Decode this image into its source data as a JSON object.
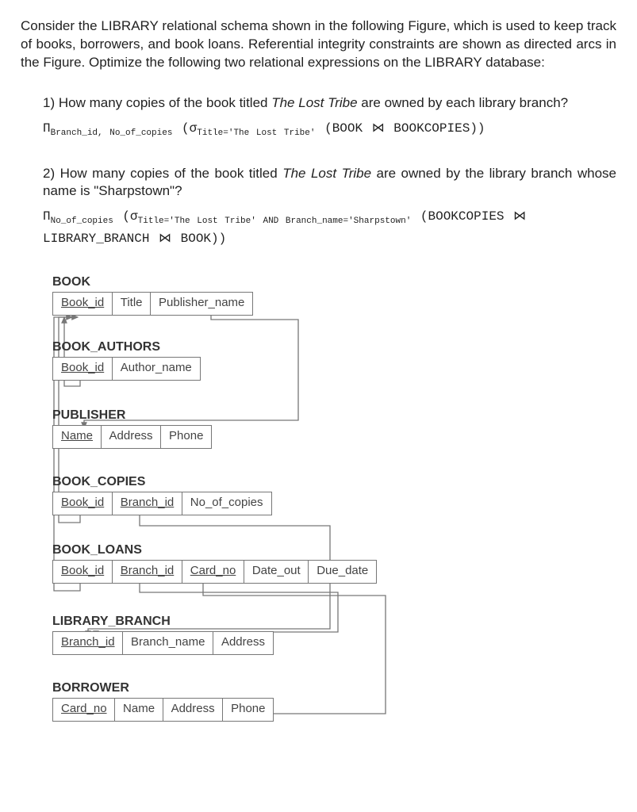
{
  "intro": "Consider the LIBRARY relational schema shown in the following Figure, which is used to keep track of books, borrowers, and book loans. Referential integrity constraints are shown as directed arcs in the Figure. Optimize the following two relational expressions on the LIBRARY database:",
  "q1": {
    "num": "1) ",
    "text": "How many copies of the book titled ",
    "title": "The Lost Tribe",
    "text2": " are owned by each library branch?",
    "ra_pi": "Π",
    "ra_sub1": "Branch_id, No_of_copies",
    "ra_mid": " (σ",
    "ra_sub2": "Title='The Lost Tribe'",
    "ra_join": " (BOOK ⋈ BOOKCOPIES))"
  },
  "q2": {
    "num": "2) ",
    "text": "How many copies of the book titled ",
    "title": "The Lost Tribe",
    "text2": " are owned by the library branch whose name is \"Sharpstown\"?",
    "ra_pi": "Π",
    "ra_sub1": "No_of_copies",
    "ra_mid": " (σ",
    "ra_sub2": "Title='The Lost Tribe' AND Branch_name='Sharpstown'",
    "ra_tail1": " (BOOKCOPIES ⋈",
    "ra_tail2": "LIBRARY_BRANCH ⋈ BOOK))"
  },
  "schema": {
    "book": {
      "name": "BOOK",
      "cols": [
        "Book_id",
        "Title",
        "Publisher_name"
      ]
    },
    "authors": {
      "name": "BOOK_AUTHORS",
      "cols": [
        "Book_id",
        "Author_name"
      ]
    },
    "publisher": {
      "name": "PUBLISHER",
      "cols": [
        "Name",
        "Address",
        "Phone"
      ]
    },
    "copies": {
      "name": "BOOK_COPIES",
      "cols": [
        "Book_id",
        "Branch_id",
        "No_of_copies"
      ]
    },
    "loans": {
      "name": "BOOK_LOANS",
      "cols": [
        "Book_id",
        "Branch_id",
        "Card_no",
        "Date_out",
        "Due_date"
      ]
    },
    "branch": {
      "name": "LIBRARY_BRANCH",
      "cols": [
        "Branch_id",
        "Branch_name",
        "Address"
      ]
    },
    "borrower": {
      "name": "BORROWER",
      "cols": [
        "Card_no",
        "Name",
        "Address",
        "Phone"
      ]
    }
  }
}
